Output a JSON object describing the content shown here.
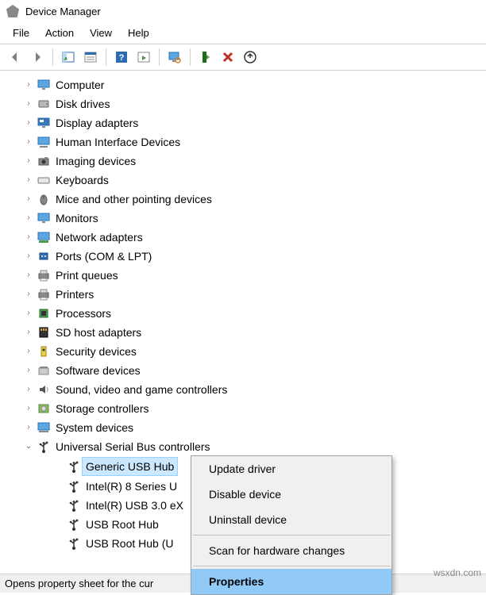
{
  "window": {
    "title": "Device Manager"
  },
  "menubar": {
    "file": "File",
    "action": "Action",
    "view": "View",
    "help": "Help"
  },
  "tree": {
    "categories": [
      {
        "label": "Computer",
        "icon": "monitor"
      },
      {
        "label": "Disk drives",
        "icon": "disk"
      },
      {
        "label": "Display adapters",
        "icon": "display"
      },
      {
        "label": "Human Interface Devices",
        "icon": "hid"
      },
      {
        "label": "Imaging devices",
        "icon": "camera"
      },
      {
        "label": "Keyboards",
        "icon": "keyboard"
      },
      {
        "label": "Mice and other pointing devices",
        "icon": "mouse"
      },
      {
        "label": "Monitors",
        "icon": "monitor"
      },
      {
        "label": "Network adapters",
        "icon": "network"
      },
      {
        "label": "Ports (COM & LPT)",
        "icon": "port"
      },
      {
        "label": "Print queues",
        "icon": "printer"
      },
      {
        "label": "Printers",
        "icon": "printer"
      },
      {
        "label": "Processors",
        "icon": "cpu"
      },
      {
        "label": "SD host adapters",
        "icon": "sd"
      },
      {
        "label": "Security devices",
        "icon": "security"
      },
      {
        "label": "Software devices",
        "icon": "software"
      },
      {
        "label": "Sound, video and game controllers",
        "icon": "sound"
      },
      {
        "label": "Storage controllers",
        "icon": "storage"
      },
      {
        "label": "System devices",
        "icon": "system"
      },
      {
        "label": "Universal Serial Bus controllers",
        "icon": "usb",
        "expanded": true
      }
    ],
    "usb_children": [
      {
        "label": "Generic USB Hub",
        "icon": "usb",
        "selected": true
      },
      {
        "label": "Intel(R) 8 Series U",
        "icon": "usb"
      },
      {
        "label": "Intel(R) USB 3.0 eX",
        "icon": "usb"
      },
      {
        "label": "USB Root Hub",
        "icon": "usb"
      },
      {
        "label": "USB Root Hub (U",
        "icon": "usb"
      }
    ]
  },
  "context_menu": {
    "update_driver": "Update driver",
    "disable_device": "Disable device",
    "uninstall_device": "Uninstall device",
    "scan_hardware": "Scan for hardware changes",
    "properties": "Properties"
  },
  "statusbar": {
    "text": "Opens property sheet for the cur"
  },
  "watermark": "wsxdn.com"
}
